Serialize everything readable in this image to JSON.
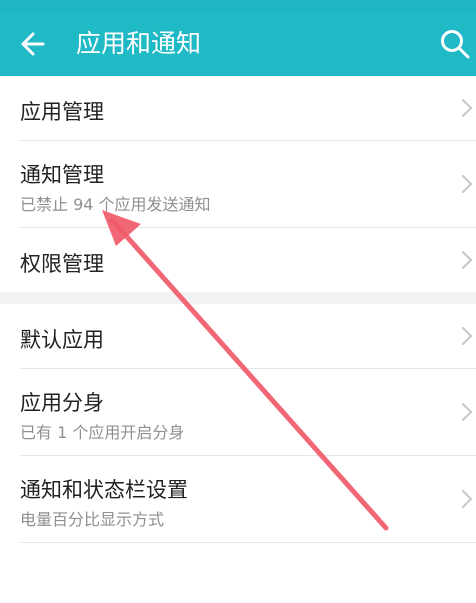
{
  "app_bar": {
    "title": "应用和通知",
    "back_icon": "arrow-left-icon",
    "search_icon": "search-icon",
    "background": "#20b9c6"
  },
  "sections": [
    {
      "items": [
        {
          "title": "应用管理",
          "subtitle": ""
        },
        {
          "title": "通知管理",
          "subtitle": "已禁止 94 个应用发送通知"
        },
        {
          "title": "权限管理",
          "subtitle": ""
        }
      ]
    },
    {
      "items": [
        {
          "title": "默认应用",
          "subtitle": ""
        },
        {
          "title": "应用分身",
          "subtitle": "已有 1 个应用开启分身"
        },
        {
          "title": "通知和状态栏设置",
          "subtitle": "电量百分比显示方式"
        }
      ]
    }
  ],
  "annotation": {
    "type": "arrow",
    "color": "#f05a6a"
  }
}
